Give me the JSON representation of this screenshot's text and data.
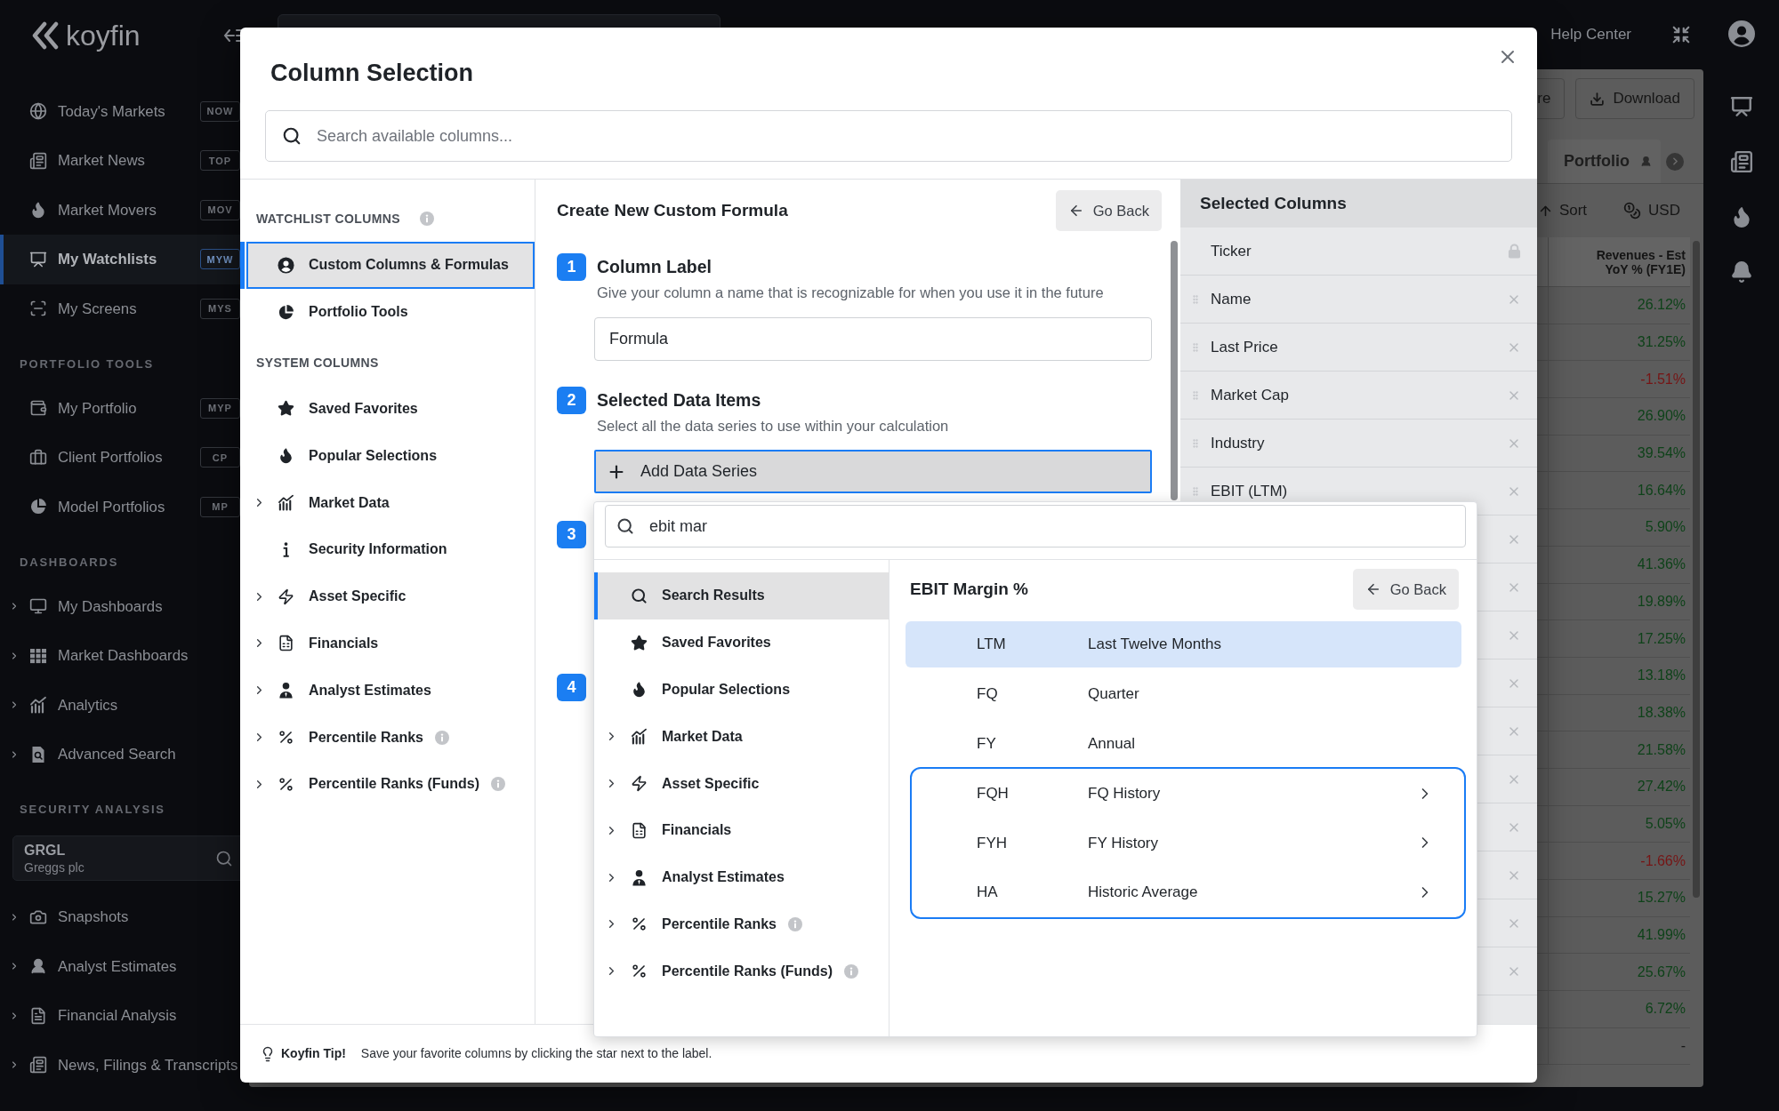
{
  "sidebar": {
    "logo": "koyfin",
    "groups": [
      {
        "items": [
          {
            "label": "Today's Markets",
            "shortcut": "NOW",
            "expandable": false,
            "selected": false
          },
          {
            "label": "Market News",
            "shortcut": "TOP",
            "expandable": false,
            "selected": false
          },
          {
            "label": "Market Movers",
            "shortcut": "MOV",
            "expandable": false,
            "selected": false
          },
          {
            "label": "My Watchlists",
            "shortcut": "MYW",
            "expandable": false,
            "selected": true
          },
          {
            "label": "My Screens",
            "shortcut": "MYS",
            "expandable": false,
            "selected": false
          }
        ]
      },
      {
        "heading": "PORTFOLIO TOOLS",
        "items": [
          {
            "label": "My Portfolio",
            "shortcut": "MYP",
            "expandable": false,
            "selected": false
          },
          {
            "label": "Client Portfolios",
            "shortcut": "CP",
            "expandable": false,
            "selected": false
          },
          {
            "label": "Model Portfolios",
            "shortcut": "MP",
            "expandable": false,
            "selected": false
          }
        ]
      },
      {
        "heading": "DASHBOARDS",
        "items": [
          {
            "label": "My Dashboards",
            "expandable": true,
            "selected": false
          },
          {
            "label": "Market Dashboards",
            "expandable": true,
            "selected": false
          },
          {
            "label": "Analytics",
            "expandable": true,
            "selected": false
          },
          {
            "label": "Advanced Search",
            "expandable": true,
            "selected": false
          }
        ]
      },
      {
        "heading": "SECURITY ANALYSIS",
        "security": {
          "ticker": "GRGL",
          "name": "Greggs plc"
        },
        "items": [
          {
            "label": "Snapshots",
            "expandable": true,
            "selected": false
          },
          {
            "label": "Analyst Estimates",
            "expandable": true,
            "selected": false
          },
          {
            "label": "Financial Analysis",
            "expandable": true,
            "selected": false
          },
          {
            "label": "News, Filings & Transcripts",
            "expandable": true,
            "selected": false
          }
        ]
      }
    ]
  },
  "top_bar": {
    "help": "Help Center"
  },
  "watchlist": {
    "buttons": [
      {
        "label": "re",
        "kind": "plain"
      },
      {
        "label": "Download",
        "kind": "download"
      }
    ],
    "tabs": [
      {
        "label": "Portfolio",
        "selected": false
      }
    ],
    "sort": "Sort",
    "currency": "USD",
    "table": {
      "column": "Revenues - Est YoY % (FY1E)",
      "rows": [
        {
          "value": "26.12%",
          "color": "#0e4219"
        },
        {
          "value": "31.25%",
          "color": "#0e4219"
        },
        {
          "value": "-1.51%",
          "color": "#761515"
        },
        {
          "value": "26.90%",
          "color": "#0e4219"
        },
        {
          "value": "39.54%",
          "color": "#0e4219"
        },
        {
          "value": "16.64%",
          "color": "#0e4219"
        },
        {
          "value": "5.90%",
          "color": "#0e4219"
        },
        {
          "value": "41.36%",
          "color": "#0e4219"
        },
        {
          "value": "19.89%",
          "color": "#0e4219"
        },
        {
          "value": "17.25%",
          "color": "#0e4219"
        },
        {
          "value": "13.18%",
          "color": "#0e4219"
        },
        {
          "value": "18.38%",
          "color": "#0e4219"
        },
        {
          "value": "21.58%",
          "color": "#0e4219"
        },
        {
          "value": "27.42%",
          "color": "#0e4219"
        },
        {
          "value": "5.05%",
          "color": "#0e4219"
        },
        {
          "value": "-1.66%",
          "color": "#761515"
        },
        {
          "value": "15.27%",
          "color": "#0e4219"
        },
        {
          "value": "41.99%",
          "color": "#0e4219"
        },
        {
          "value": "25.67%",
          "color": "#0e4219"
        },
        {
          "value": "6.72%",
          "color": "#0e4219"
        },
        {
          "value": "-",
          "color": "#161616"
        }
      ]
    }
  },
  "modal": {
    "title": "Column Selection",
    "search": {
      "placeholder": "Search available columns..."
    },
    "categories": [
      {
        "heading": "WATCHLIST COLUMNS",
        "info": true,
        "items": [
          {
            "label": "Custom Columns & Formulas",
            "selected": true,
            "expandable": false,
            "info": false
          },
          {
            "label": "Portfolio Tools",
            "selected": false,
            "expandable": false,
            "info": false
          }
        ]
      },
      {
        "heading": "SYSTEM COLUMNS",
        "info": false,
        "items": [
          {
            "label": "Saved Favorites",
            "selected": false,
            "expandable": false,
            "info": false
          },
          {
            "label": "Popular Selections",
            "selected": false,
            "expandable": false,
            "info": false
          },
          {
            "label": "Market Data",
            "selected": false,
            "expandable": true,
            "info": false
          },
          {
            "label": "Security Information",
            "selected": false,
            "expandable": false,
            "info": false
          },
          {
            "label": "Asset Specific",
            "selected": false,
            "expandable": true,
            "info": false
          },
          {
            "label": "Financials",
            "selected": false,
            "expandable": true,
            "info": false
          },
          {
            "label": "Analyst Estimates",
            "selected": false,
            "expandable": true,
            "info": false
          },
          {
            "label": "Percentile Ranks",
            "selected": false,
            "expandable": true,
            "info": true
          },
          {
            "label": "Percentile Ranks (Funds)",
            "selected": false,
            "expandable": true,
            "info": true
          }
        ]
      }
    ],
    "formula": {
      "title": "Create New Custom Formula",
      "back": "Go Back",
      "steps": [
        {
          "number": "1",
          "title": "Column Label",
          "description": "Give your column a name that is recognizable for when you use it in the future",
          "field": {
            "value": "Formula"
          }
        },
        {
          "number": "2",
          "title": "Selected Data Items",
          "description": "Select all the data series to use within your calculation",
          "button": {
            "label": "Add Data Series",
            "open": true
          }
        },
        {
          "number": "3"
        },
        {
          "number": "4"
        }
      ]
    },
    "picker": {
      "search": {
        "value": "ebit mar"
      },
      "categories": [
        {
          "label": "Search Results",
          "selected": true,
          "expandable": false,
          "info": false
        },
        {
          "label": "Saved Favorites",
          "selected": false,
          "expandable": false,
          "info": false
        },
        {
          "label": "Popular Selections",
          "selected": false,
          "expandable": false,
          "info": false
        },
        {
          "label": "Market Data",
          "selected": false,
          "expandable": true,
          "info": false
        },
        {
          "label": "Asset Specific",
          "selected": false,
          "expandable": true,
          "info": false
        },
        {
          "label": "Financials",
          "selected": false,
          "expandable": true,
          "info": false
        },
        {
          "label": "Analyst Estimates",
          "selected": false,
          "expandable": true,
          "info": false
        },
        {
          "label": "Percentile Ranks",
          "selected": false,
          "expandable": true,
          "info": true
        },
        {
          "label": "Percentile Ranks (Funds)",
          "selected": false,
          "expandable": true,
          "info": true
        }
      ],
      "detail": {
        "title": "EBIT Margin %",
        "back": "Go Back",
        "periods": [
          {
            "code": "LTM",
            "label": "Last Twelve Months",
            "selected": true
          },
          {
            "code": "FQ",
            "label": "Quarter",
            "selected": false
          },
          {
            "code": "FY",
            "label": "Annual",
            "selected": false
          }
        ],
        "history_group": {
          "highlighted": true,
          "options": [
            {
              "code": "FQH",
              "label": "FQ History",
              "selected": false
            },
            {
              "code": "FYH",
              "label": "FY History",
              "selected": false
            },
            {
              "code": "HA",
              "label": "Historic Average",
              "selected": false
            }
          ]
        }
      }
    },
    "selected_columns": {
      "title": "Selected Columns",
      "rows": [
        {
          "name": "Ticker",
          "locked": true
        },
        {
          "name": "Name",
          "locked": false
        },
        {
          "name": "Last Price",
          "locked": false
        },
        {
          "name": "Market Cap",
          "locked": false
        },
        {
          "name": "Industry",
          "locked": false
        },
        {
          "name": "EBIT (LTM)",
          "locked": false
        },
        {
          "locked": false
        },
        {
          "locked": false
        },
        {
          "locked": false
        },
        {
          "locked": false
        },
        {
          "locked": false
        },
        {
          "locked": false
        },
        {
          "locked": false
        },
        {
          "locked": false
        },
        {
          "locked": false
        },
        {
          "locked": false
        }
      ]
    },
    "tip": {
      "label": "Koyfin Tip!",
      "text": "Save your favorite columns by clicking the star next to the label."
    }
  }
}
